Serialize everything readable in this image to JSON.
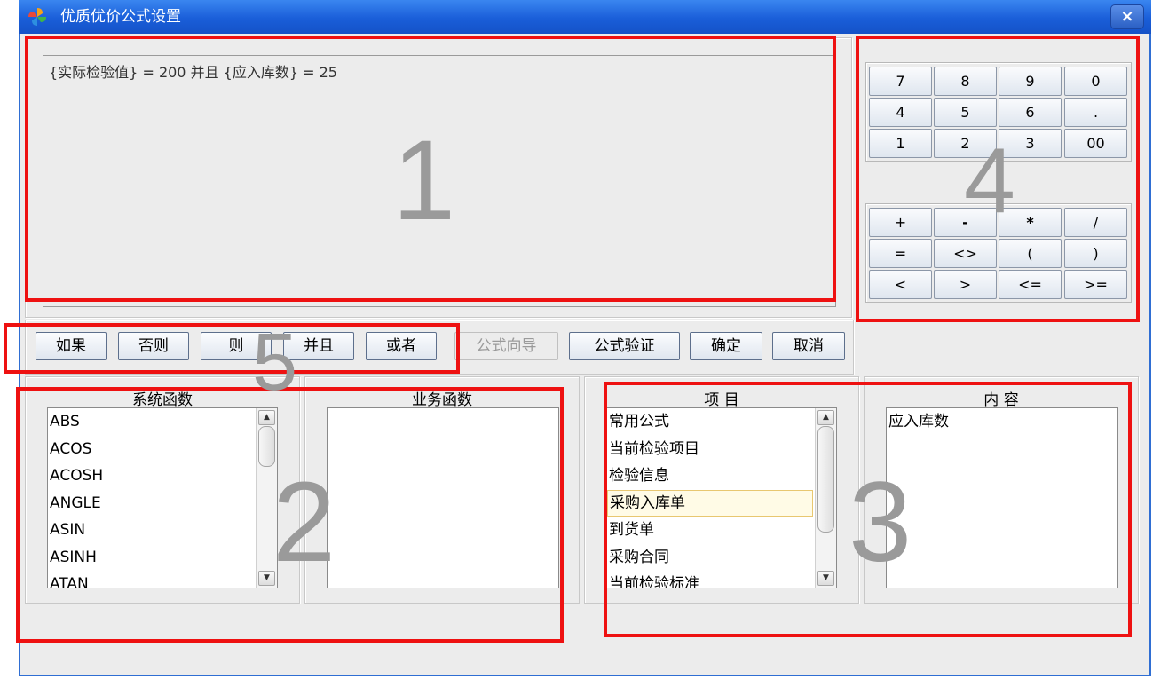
{
  "window": {
    "title": "优质优价公式设置",
    "close_label": "×"
  },
  "formula": {
    "text": "{实际检验值} = 200 并且 {应入库数} = 25"
  },
  "keypad": {
    "digits": [
      [
        "7",
        "8",
        "9",
        "0"
      ],
      [
        "4",
        "5",
        "6",
        "."
      ],
      [
        "1",
        "2",
        "3",
        "00"
      ]
    ],
    "operators": [
      [
        "+",
        "-",
        "*",
        "/"
      ],
      [
        "=",
        "<>",
        "(",
        ")"
      ],
      [
        "<",
        ">",
        "<=",
        ">="
      ]
    ]
  },
  "buttons": {
    "if": "如果",
    "else": "否则",
    "then": "则",
    "and": "并且",
    "or": "或者",
    "wizard": "公式向导",
    "validate": "公式验证",
    "ok": "确定",
    "cancel": "取消"
  },
  "system_functions": {
    "header": "系统函数",
    "items": [
      "ABS",
      "ACOS",
      "ACOSH",
      "ANGLE",
      "ASIN",
      "ASINH",
      "ATAN"
    ]
  },
  "business_functions": {
    "header": "业务函数",
    "items": []
  },
  "project": {
    "header": "项 目",
    "items": [
      "常用公式",
      "当前检验项目",
      "检验信息",
      "采购入库单",
      "到货单",
      "采购合同",
      "当前检验标准"
    ],
    "selected": "采购入库单"
  },
  "content": {
    "header": "内 容",
    "items": [
      "应入库数"
    ]
  },
  "annotations": {
    "labels": [
      "1",
      "2",
      "3",
      "4",
      "5"
    ]
  },
  "colors": {
    "titlebar": "#1a5ed9",
    "annotation": "#ee1111",
    "window_bg": "#ececec",
    "selection_bg": "#fffbe6"
  }
}
